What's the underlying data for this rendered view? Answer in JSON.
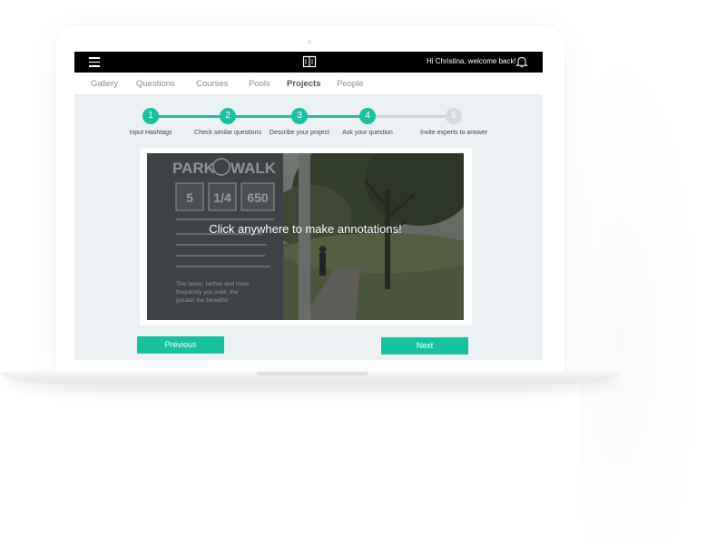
{
  "header": {
    "greeting": "Hi Christina, welcome back!",
    "menu_icon": "hamburger-icon",
    "logo_icon": "book-icon",
    "notification_icon": "bell-icon"
  },
  "nav": {
    "items": [
      {
        "label": "Gallery",
        "active": false
      },
      {
        "label": "Questions",
        "active": false
      },
      {
        "label": "Courses",
        "active": false
      },
      {
        "label": "Pools",
        "active": false
      },
      {
        "label": "Projects",
        "active": true
      },
      {
        "label": "People",
        "active": false
      }
    ]
  },
  "stepper": {
    "current_step": 4,
    "steps": [
      {
        "number": "1",
        "label": "Input Hashtags",
        "done": true
      },
      {
        "number": "2",
        "label": "Check similar questions",
        "done": true
      },
      {
        "number": "3",
        "label": "Describe your project",
        "done": true
      },
      {
        "number": "4",
        "label": "Ask your question",
        "done": true
      },
      {
        "number": "5",
        "label": "Invite experts to answer",
        "done": false
      }
    ]
  },
  "image": {
    "overlay_text": "Click anywhere to make annotations!",
    "sign": {
      "title_left": "PARK",
      "title_right": "WALK",
      "stats": [
        "5",
        "1/4",
        "650"
      ],
      "bottom_text": [
        "The faster, farther and more",
        "frequently you walk, the",
        "greater the benefits!"
      ]
    }
  },
  "buttons": {
    "previous": "Previous",
    "next": "Next"
  },
  "colors": {
    "accent": "#17c2a0",
    "inactive": "#cfd6d9",
    "topbar": "#000000",
    "screen_bg": "#ecf1f4"
  }
}
